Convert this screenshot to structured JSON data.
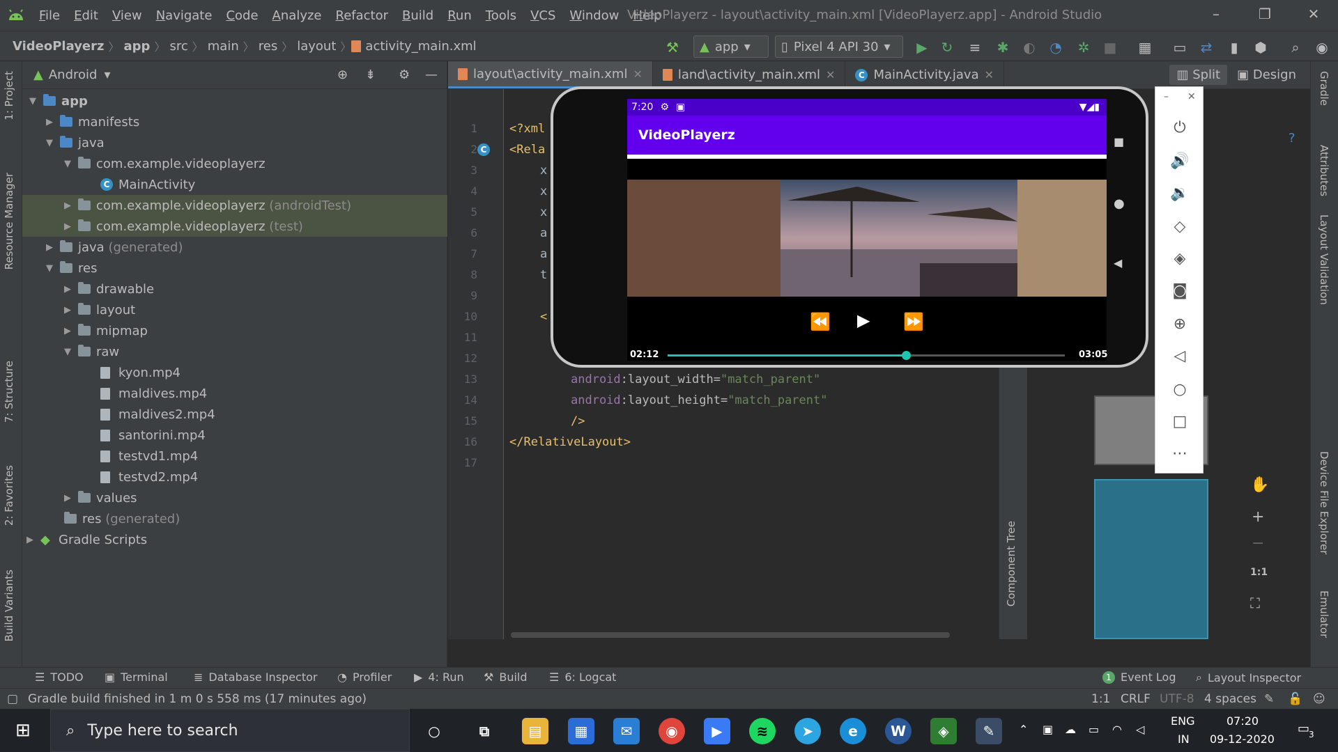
{
  "window": {
    "title": "VideoPlayerz - layout\\activity_main.xml [VideoPlayerz.app] - Android Studio",
    "menu": [
      "File",
      "Edit",
      "View",
      "Navigate",
      "Code",
      "Analyze",
      "Refactor",
      "Build",
      "Run",
      "Tools",
      "VCS",
      "Window",
      "Help"
    ]
  },
  "breadcrumb": [
    "VideoPlayerz",
    "app",
    "src",
    "main",
    "res",
    "layout",
    "activity_main.xml"
  ],
  "toolbar": {
    "run_config": "app",
    "device": "Pixel 4 API 30"
  },
  "left_strip": {
    "project": "1: Project",
    "resource_manager": "Resource Manager",
    "structure": "7: Structure",
    "favorites": "2: Favorites",
    "build_variants": "Build Variants"
  },
  "project": {
    "view": "Android",
    "tree": [
      {
        "label": "app",
        "suffix": ""
      },
      {
        "label": "manifests",
        "suffix": ""
      },
      {
        "label": "java",
        "suffix": ""
      },
      {
        "label": "com.example.videoplayerz",
        "suffix": ""
      },
      {
        "label": "MainActivity",
        "suffix": ""
      },
      {
        "label": "com.example.videoplayerz",
        "suffix": "(androidTest)"
      },
      {
        "label": "com.example.videoplayerz",
        "suffix": "(test)"
      },
      {
        "label": "java",
        "suffix": "(generated)"
      },
      {
        "label": "res",
        "suffix": ""
      },
      {
        "label": "drawable",
        "suffix": ""
      },
      {
        "label": "layout",
        "suffix": ""
      },
      {
        "label": "mipmap",
        "suffix": ""
      },
      {
        "label": "raw",
        "suffix": ""
      },
      {
        "label": "kyon.mp4",
        "suffix": ""
      },
      {
        "label": "maldives.mp4",
        "suffix": ""
      },
      {
        "label": "maldives2.mp4",
        "suffix": ""
      },
      {
        "label": "santorini.mp4",
        "suffix": ""
      },
      {
        "label": "testvd1.mp4",
        "suffix": ""
      },
      {
        "label": "testvd2.mp4",
        "suffix": ""
      },
      {
        "label": "values",
        "suffix": ""
      },
      {
        "label": "res",
        "suffix": "(generated)"
      },
      {
        "label": "Gradle Scripts",
        "suffix": ""
      }
    ]
  },
  "editor_tabs": [
    "layout\\activity_main.xml",
    "land\\activity_main.xml",
    "MainActivity.java"
  ],
  "editor": {
    "line_numbers": [
      "1",
      "2",
      "3",
      "4",
      "5",
      "6",
      "7",
      "8",
      "9",
      "10",
      "11",
      "12",
      "13",
      "14",
      "15",
      "16",
      "17"
    ],
    "line1": "<?xml",
    "line2": "<Rela",
    "partial_lines": [
      "x",
      "x",
      "x",
      "a",
      "a",
      "t"
    ],
    "line10": "<",
    "line13": {
      "ns": "android",
      "attr": ":layout_width=",
      "val": "\"match_parent\""
    },
    "line14": {
      "ns": "android",
      "attr": ":layout_height=",
      "val": "\"match_parent\""
    },
    "line15": "/>",
    "line16": "</RelativeLayout>"
  },
  "design": {
    "split": "Split",
    "design": "Design",
    "component_tree": "Component Tree",
    "attributes": "Attributes",
    "zoom_fit": "1:1"
  },
  "right_strip": {
    "gradle": "Gradle",
    "layout_validation": "Layout Validation",
    "device_file_explorer": "Device File Explorer",
    "emulator": "Emulator"
  },
  "emulator": {
    "status_time": "7:20",
    "app_title": "VideoPlayerz",
    "time_current": "02:12",
    "time_total": "03:05",
    "progress": 0.6
  },
  "bottom_tools": [
    "TODO",
    "Terminal",
    "Database Inspector",
    "Profiler",
    "4: Run",
    "Build",
    "6: Logcat"
  ],
  "bottom_right_tools": {
    "event_log": "Event Log",
    "event_count": "1",
    "layout_inspector": "Layout Inspector"
  },
  "status": {
    "message": "Gradle build finished in 1 m 0 s 558 ms (17 minutes ago)",
    "position": "1:1",
    "line_sep": "CRLF",
    "encoding": "UTF-8",
    "indent": "4 spaces"
  },
  "taskbar": {
    "search_placeholder": "Type here to search",
    "lang_top": "ENG",
    "lang_bottom": "IN",
    "time": "07:20",
    "date": "09-12-2020",
    "notifications": "3"
  }
}
